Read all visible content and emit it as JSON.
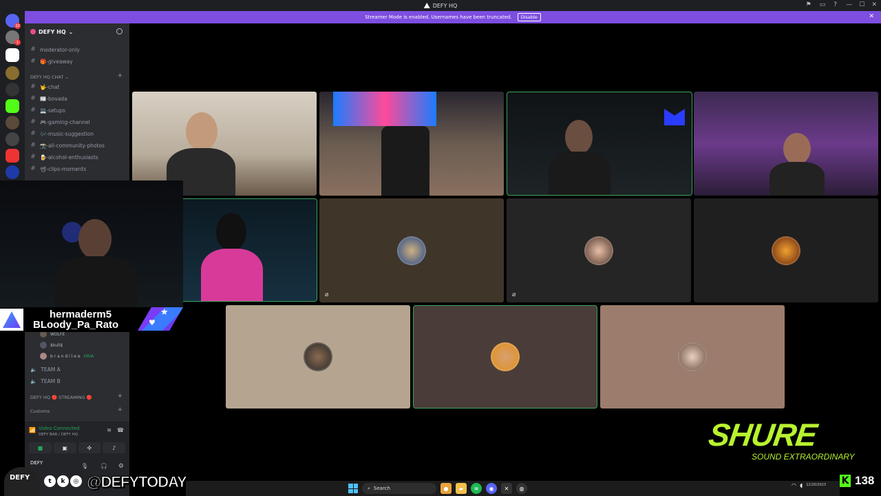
{
  "window": {
    "title": "DEFY HQ",
    "controls": [
      "—",
      "☐",
      "✕"
    ]
  },
  "banner": {
    "text": "Streamer Mode is enabled. Usernames have been truncated.",
    "button": "Disable"
  },
  "server_badges": {
    "dm": "22",
    "second": "1"
  },
  "guild": {
    "name": "DEFY HQ"
  },
  "channels_top": [
    {
      "name": "moderator-only"
    },
    {
      "name": "🎁-giveaway"
    }
  ],
  "category_chat": "DEFY HQ CHAT",
  "channels_chat": [
    {
      "name": "🤟-chat"
    },
    {
      "name": "📰-bovada"
    },
    {
      "name": "💻-setups"
    },
    {
      "name": "🎮-gaming-channel"
    },
    {
      "name": "🎶-music-suggestion"
    },
    {
      "name": "📸-all-community-photos"
    },
    {
      "name": "🍺-alcohol-enthusiasts"
    },
    {
      "name": "📽-clips-moments"
    }
  ],
  "voice_users": [
    {
      "name": "WOLFE",
      "badge": ""
    },
    {
      "name": "$kull$",
      "badge": ""
    },
    {
      "name": "b r a n d i l e e",
      "badge": "HRIA"
    }
  ],
  "teams": [
    "TEAM A",
    "TEAM B"
  ],
  "category_streaming": "DEFY HQ 🔴 STREAMING 🔴",
  "category_customs": "Customs",
  "voice_panel": {
    "status": "Video Connected",
    "channel": "DEFY BAR / DEFY HQ",
    "user": "DEFY"
  },
  "overlay": {
    "name1": "hermaderm5",
    "name2": "BLoody_Pa_Rato"
  },
  "social": {
    "handle": "@DEFYTODAY",
    "face_label": "DEFY",
    "icons": [
      "twitter-icon",
      "kick-icon",
      "instagram-icon"
    ]
  },
  "sponsor": {
    "logo": "SHURE",
    "tagline": "SOUND EXTRAORDINARY"
  },
  "kick": {
    "viewers": "138"
  },
  "taskbar": {
    "search": "Search",
    "date": "12/20/2023"
  },
  "colors": {
    "banner": "#7d4ee0",
    "sidebar": "#2b2d31",
    "active_speaker": "#3ba55d",
    "shure": "#b8f22e",
    "kick": "#53fc18"
  }
}
